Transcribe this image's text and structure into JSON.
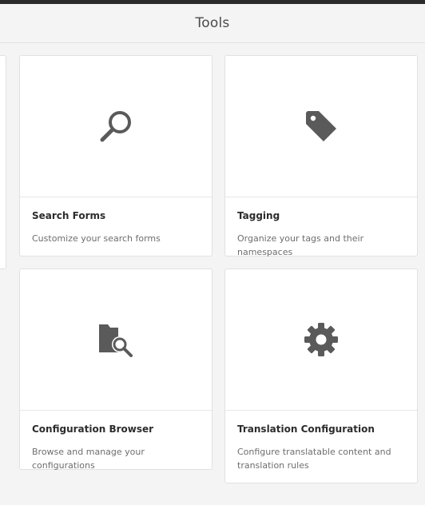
{
  "header": {
    "title": "Tools"
  },
  "cards": [
    {
      "icon": "search-icon",
      "title": "Search Forms",
      "description": "Customize your search forms"
    },
    {
      "icon": "tag-icon",
      "title": "Tagging",
      "description": "Organize your tags and their namespaces"
    },
    {
      "icon": "folder-search-icon",
      "title": "Configuration Browser",
      "description": "Browse and manage your configurations"
    },
    {
      "icon": "gear-icon",
      "title": "Translation Configuration",
      "description": "Configure translatable content and translation rules"
    }
  ],
  "colors": {
    "icon": "#5a5a5a",
    "background": "#f4f4f4",
    "card": "#ffffff",
    "topbar": "#2b2b2b"
  }
}
